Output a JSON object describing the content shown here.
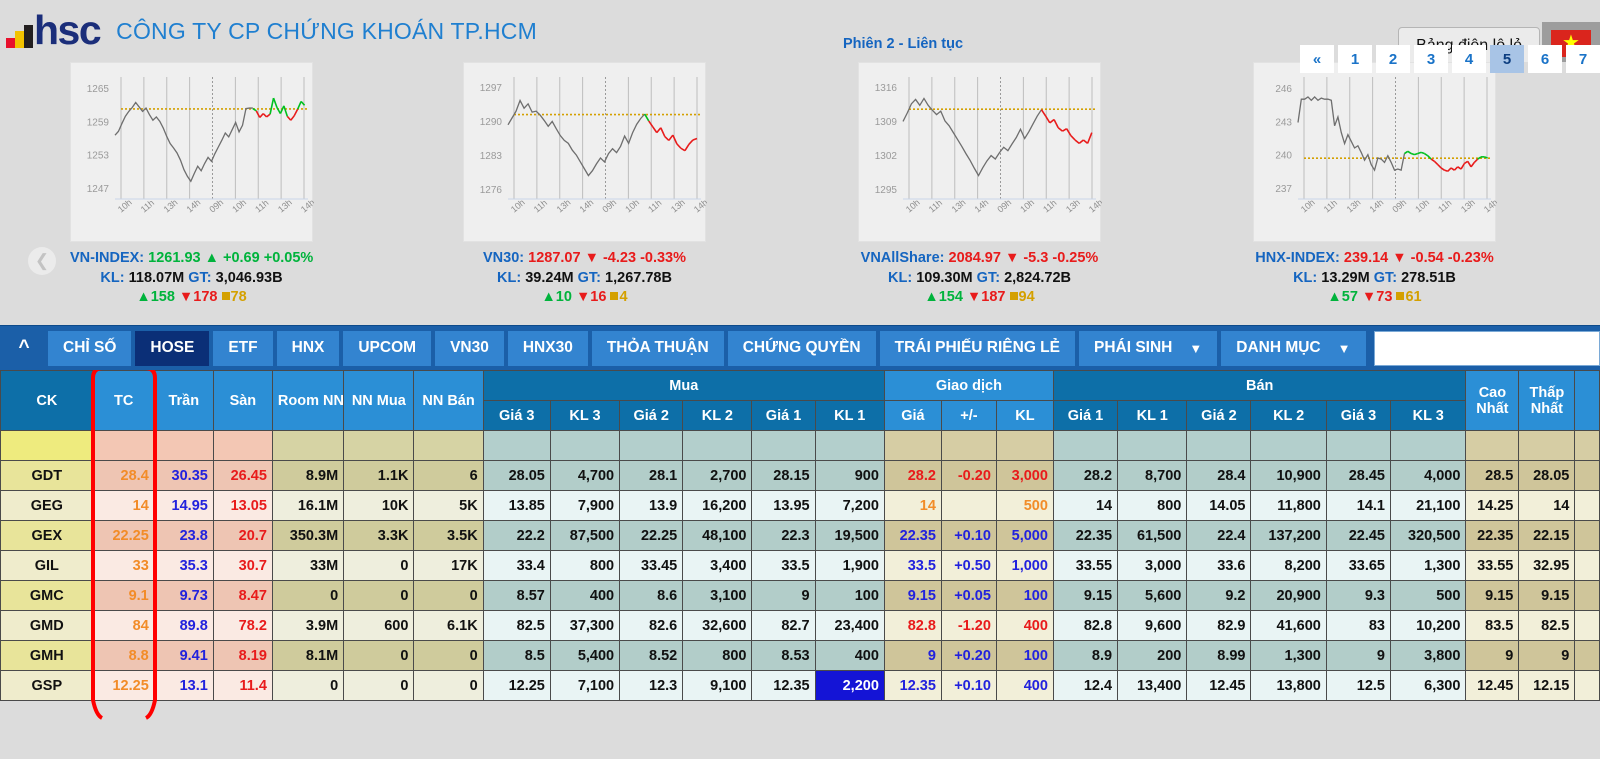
{
  "header": {
    "logo_text": "hsc",
    "company_name": "CÔNG TY CP CHỨNG KHOÁN TP.HCM",
    "session_status": "Phiên 2 - Liên tục",
    "lot_button": "Bảng điện lô lẻ",
    "flag_icon": "vietnam-flag-icon",
    "prev_arrow_icon": "chevron-left-icon"
  },
  "indices": [
    {
      "name": "VN-INDEX",
      "value": "1261.93",
      "dir": "up",
      "arrow": "▲",
      "change": "+0.69",
      "percent": "+0.05%",
      "vol_label": "KL:",
      "vol": "118.07M",
      "val_label": "GT:",
      "val": "3,046.93B",
      "advancers": "158",
      "decliners": "178",
      "unchanged": "78",
      "chart_data": {
        "type": "line",
        "title": "VN-INDEX",
        "yticks": [
          1265,
          1259,
          1253,
          1247
        ],
        "ylim": [
          1245,
          1267
        ],
        "xticks": [
          "10h",
          "11h",
          "13h",
          "14h",
          "09h",
          "10h",
          "11h",
          "13h",
          "14h"
        ],
        "reference": 1261.24,
        "prev_series": [
          1256.5,
          1257.2,
          1258.6,
          1259.9,
          1260.8,
          1261.5,
          1262.4,
          1261.6,
          1260.8,
          1261.4,
          1260.2,
          1259.2,
          1259.8,
          1259.0,
          1257.8,
          1256.3,
          1255.0,
          1254.2,
          1253.3,
          1252.0,
          1250.3,
          1249.1,
          1248.2,
          1249.6,
          1250.9,
          1250.1,
          1251.4,
          1252.5,
          1251.8,
          1253.2,
          1254.4,
          1255.6,
          1256.9,
          1256.2,
          1257.5,
          1258.8,
          1257.1,
          1258.3,
          1261.3,
          1261.4,
          1261.4
        ],
        "today_series": [
          1261.3,
          1260.9,
          1259.7,
          1260.4,
          1259.8,
          1260.3,
          1263.2,
          1261.5,
          1260.4,
          1261.8,
          1259.9,
          1259.2,
          1260.0,
          1261.2,
          1262.6,
          1261.9
        ],
        "today_color": "mixed"
      }
    },
    {
      "name": "VN30",
      "value": "1287.07",
      "dir": "down",
      "arrow": "▼",
      "change": "-4.23",
      "percent": "-0.33%",
      "vol_label": "KL:",
      "vol": "39.24M",
      "val_label": "GT:",
      "val": "1,267.78B",
      "advancers": "10",
      "decliners": "16",
      "unchanged": "4",
      "chart_data": {
        "type": "line",
        "title": "VN30",
        "yticks": [
          1297,
          1290,
          1283,
          1276
        ],
        "ylim": [
          1274,
          1299
        ],
        "xticks": [
          "10h",
          "11h",
          "13h",
          "14h",
          "09h",
          "10h",
          "11h",
          "13h",
          "14h"
        ],
        "reference": 1291.3,
        "prev_series": [
          1289.2,
          1290.6,
          1292.0,
          1294.2,
          1292.6,
          1293.5,
          1291.8,
          1292.0,
          1291.2,
          1290.1,
          1288.9,
          1289.9,
          1288.4,
          1287.0,
          1286.0,
          1285.4,
          1284.0,
          1283.0,
          1281.6,
          1280.2,
          1278.8,
          1279.8,
          1281.2,
          1282.4,
          1281.6,
          1283.3,
          1284.3,
          1283.5,
          1284.8,
          1286.9,
          1285.4,
          1287.6,
          1289.3,
          1290.5,
          1291.4
        ],
        "today_series": [
          1291.4,
          1290.0,
          1288.8,
          1287.6,
          1288.6,
          1286.8,
          1286.0,
          1287.1,
          1285.3,
          1284.4,
          1283.9,
          1285.2,
          1286.1,
          1286.4
        ],
        "today_color": "down"
      }
    },
    {
      "name": "VNAllShare",
      "value": "2084.97",
      "dir": "down",
      "arrow": "▼",
      "change": "-5.3",
      "percent": "-0.25%",
      "vol_label": "KL:",
      "vol": "109.30M",
      "val_label": "GT:",
      "val": "2,824.72B",
      "advancers": "154",
      "decliners": "187",
      "unchanged": "94",
      "chart_data": {
        "type": "line",
        "title": "VNAllShare",
        "yticks": [
          1316,
          1309,
          1302,
          1295
        ],
        "ylim": [
          1293,
          1318
        ],
        "xticks": [
          "10h",
          "11h",
          "13h",
          "14h",
          "09h",
          "10h",
          "11h",
          "13h",
          "14h"
        ],
        "reference": 1311.4,
        "prev_series": [
          1308.9,
          1310.6,
          1312.5,
          1313.4,
          1312.2,
          1313.6,
          1312.2,
          1311.2,
          1310.3,
          1311.0,
          1309.0,
          1308.0,
          1306.6,
          1305.2,
          1303.8,
          1302.3,
          1300.9,
          1299.3,
          1297.8,
          1299.4,
          1300.8,
          1301.9,
          1301.2,
          1302.5,
          1303.6,
          1302.9,
          1304.3,
          1305.6,
          1307.3,
          1305.4,
          1306.8,
          1308.4,
          1310.0,
          1311.3
        ],
        "today_series": [
          1311.3,
          1310.0,
          1308.6,
          1309.3,
          1307.6,
          1306.9,
          1307.4,
          1306.0,
          1305.1,
          1304.4,
          1305.1,
          1304.4,
          1306.6
        ],
        "today_color": "down"
      }
    },
    {
      "name": "HNX-INDEX",
      "value": "239.14",
      "dir": "down",
      "arrow": "▼",
      "change": "-0.54",
      "percent": "-0.23%",
      "vol_label": "KL:",
      "vol": "13.29M",
      "val_label": "GT:",
      "val": "278.51B",
      "advancers": "57",
      "decliners": "73",
      "unchanged": "61",
      "chart_data": {
        "type": "line",
        "title": "HNX-INDEX",
        "yticks": [
          246,
          243,
          240,
          237
        ],
        "ylim": [
          236,
          247
        ],
        "xticks": [
          "10h",
          "11h",
          "13h",
          "14h",
          "09h",
          "10h",
          "11h",
          "13h",
          "14h"
        ],
        "reference": 239.68,
        "prev_series": [
          242.9,
          245.0,
          245.0,
          245.2,
          244.9,
          245.2,
          244.9,
          245.1,
          245.0,
          245.0,
          244.9,
          242.6,
          243.4,
          242.0,
          241.0,
          241.8,
          241.2,
          240.6,
          240.8,
          240.2,
          239.5,
          240.0,
          239.1,
          238.6,
          239.7,
          239.6,
          239.3,
          239.9,
          239.3,
          238.6,
          238.7,
          238.6,
          240.1
        ],
        "today_series": [
          240.1,
          240.3,
          240.1,
          240.0,
          240.1,
          240.2,
          240.1,
          239.9,
          239.6,
          239.4,
          239.1,
          238.8,
          238.6,
          238.5,
          238.8,
          238.6,
          238.9,
          238.7,
          239.2,
          239.4,
          238.9,
          239.3,
          239.6,
          239.8,
          239.8,
          239.7
        ],
        "today_color": "mixed-down"
      }
    }
  ],
  "nav": {
    "collapse_icon": "chevron-up-icon",
    "tabs": [
      {
        "label": "CHỈ SỐ",
        "active": false,
        "chevron": false
      },
      {
        "label": "HOSE",
        "active": true,
        "chevron": false
      },
      {
        "label": "ETF",
        "active": false,
        "chevron": false
      },
      {
        "label": "HNX",
        "active": false,
        "chevron": false
      },
      {
        "label": "UPCOM",
        "active": false,
        "chevron": false
      },
      {
        "label": "VN30",
        "active": false,
        "chevron": false
      },
      {
        "label": "HNX30",
        "active": false,
        "chevron": false
      },
      {
        "label": "THỎA THUẬN",
        "active": false,
        "chevron": false
      },
      {
        "label": "CHỨNG QUYỀN",
        "active": false,
        "chevron": false
      },
      {
        "label": "TRÁI PHIẾU RIÊNG LẺ",
        "active": false,
        "chevron": false
      },
      {
        "label": "PHÁI SINH",
        "active": false,
        "chevron": true
      },
      {
        "label": "DANH MỤC",
        "active": false,
        "chevron": true
      }
    ],
    "search_value": "",
    "search_placeholder": ""
  },
  "pagination": {
    "prev_label": "«",
    "pages": [
      "1",
      "2",
      "3",
      "4",
      "5",
      "6",
      "7"
    ],
    "active_page": "5"
  },
  "table": {
    "group_headers": {
      "ck": "CK",
      "tc": "TC",
      "tran": "Trần",
      "san": "Sàn",
      "room_nn": "Room NN",
      "nn_mua": "NN Mua",
      "nn_ban": "NN Bán",
      "mua": "Mua",
      "giao_dich": "Giao dịch",
      "ban": "Bán",
      "cao_nhat_1": "Cao",
      "cao_nhat_2": "Nhất",
      "thap_nhat_1": "Thấp",
      "thap_nhat_2": "Nhất"
    },
    "sub_headers": {
      "gia3": "Giá 3",
      "kl3": "KL 3",
      "gia2": "Giá 2",
      "kl2": "KL 2",
      "gia1": "Giá 1",
      "kl1": "KL 1",
      "gd_gia": "Giá",
      "gd_pm": "+/-",
      "gd_kl": "KL",
      "s_gia1": "Giá 1",
      "s_kl1": "KL 1",
      "s_gia2": "Giá 2",
      "s_kl2": "KL 2",
      "s_gia3": "Giá 3",
      "s_kl3": "KL 3"
    },
    "rows": [
      {
        "ck": "GDT",
        "tc": "28.4",
        "tc_c": "or",
        "tran": "30.35",
        "tran_c": "bl",
        "san": "26.45",
        "san_c": "rd",
        "room_nn": "8.9M",
        "nn_mua": "1.1K",
        "nn_ban": "6",
        "m_gia3": "28.05",
        "m_kl3": "4,700",
        "m_gia2": "28.1",
        "m_kl2": "2,700",
        "m_gia1": "28.15",
        "m_kl1": "900",
        "g_gia": "28.2",
        "g_gia_c": "rd",
        "g_pm": "-0.20",
        "g_pm_c": "rd",
        "g_kl": "3,000",
        "g_kl_c": "rd",
        "b_gia1": "28.2",
        "b_kl1": "8,700",
        "b_gia2": "28.4",
        "b_kl2": "10,900",
        "b_gia3": "28.45",
        "b_kl3": "4,000",
        "cao": "28.5",
        "thap": "28.05",
        "hl": ""
      },
      {
        "ck": "GEG",
        "tc": "14",
        "tc_c": "or",
        "tran": "14.95",
        "tran_c": "bl",
        "san": "13.05",
        "san_c": "rd",
        "room_nn": "16.1M",
        "nn_mua": "10K",
        "nn_ban": "5K",
        "m_gia3": "13.85",
        "m_kl3": "7,900",
        "m_gia2": "13.9",
        "m_kl2": "16,200",
        "m_gia1": "13.95",
        "m_kl1": "7,200",
        "g_gia": "14",
        "g_gia_c": "or",
        "g_pm": "",
        "g_pm_c": "or",
        "g_kl": "500",
        "g_kl_c": "or",
        "b_gia1": "14",
        "b_kl1": "800",
        "b_gia2": "14.05",
        "b_kl2": "11,800",
        "b_gia3": "14.1",
        "b_kl3": "21,100",
        "cao": "14.25",
        "thap": "14",
        "hl": ""
      },
      {
        "ck": "GEX",
        "tc": "22.25",
        "tc_c": "or",
        "tran": "23.8",
        "tran_c": "bl",
        "san": "20.7",
        "san_c": "rd",
        "room_nn": "350.3M",
        "nn_mua": "3.3K",
        "nn_ban": "3.5K",
        "m_gia3": "22.2",
        "m_kl3": "87,500",
        "m_gia2": "22.25",
        "m_kl2": "48,100",
        "m_gia1": "22.3",
        "m_kl1": "19,500",
        "g_gia": "22.35",
        "g_gia_c": "bl",
        "g_pm": "+0.10",
        "g_pm_c": "bl",
        "g_kl": "5,000",
        "g_kl_c": "bl",
        "b_gia1": "22.35",
        "b_kl1": "61,500",
        "b_gia2": "22.4",
        "b_kl2": "137,200",
        "b_gia3": "22.45",
        "b_kl3": "320,500",
        "cao": "22.35",
        "thap": "22.15",
        "hl": ""
      },
      {
        "ck": "GIL",
        "tc": "33",
        "tc_c": "or",
        "tran": "35.3",
        "tran_c": "bl",
        "san": "30.7",
        "san_c": "rd",
        "room_nn": "33M",
        "nn_mua": "0",
        "nn_ban": "17K",
        "m_gia3": "33.4",
        "m_kl3": "800",
        "m_gia2": "33.45",
        "m_kl2": "3,400",
        "m_gia1": "33.5",
        "m_kl1": "1,900",
        "g_gia": "33.5",
        "g_gia_c": "bl",
        "g_pm": "+0.50",
        "g_pm_c": "bl",
        "g_kl": "1,000",
        "g_kl_c": "bl",
        "b_gia1": "33.55",
        "b_kl1": "3,000",
        "b_gia2": "33.6",
        "b_kl2": "8,200",
        "b_gia3": "33.65",
        "b_kl3": "1,300",
        "cao": "33.55",
        "thap": "32.95",
        "hl": ""
      },
      {
        "ck": "GMC",
        "tc": "9.1",
        "tc_c": "or",
        "tran": "9.73",
        "tran_c": "bl",
        "san": "8.47",
        "san_c": "rd",
        "room_nn": "0",
        "nn_mua": "0",
        "nn_ban": "0",
        "m_gia3": "8.57",
        "m_kl3": "400",
        "m_gia2": "8.6",
        "m_kl2": "3,100",
        "m_gia1": "9",
        "m_kl1": "100",
        "g_gia": "9.15",
        "g_gia_c": "bl",
        "g_pm": "+0.05",
        "g_pm_c": "bl",
        "g_kl": "100",
        "g_kl_c": "bl",
        "b_gia1": "9.15",
        "b_kl1": "5,600",
        "b_gia2": "9.2",
        "b_kl2": "20,900",
        "b_gia3": "9.3",
        "b_kl3": "500",
        "cao": "9.15",
        "thap": "9.15",
        "hl": ""
      },
      {
        "ck": "GMD",
        "tc": "84",
        "tc_c": "or",
        "tran": "89.8",
        "tran_c": "bl",
        "san": "78.2",
        "san_c": "rd",
        "room_nn": "3.9M",
        "nn_mua": "600",
        "nn_ban": "6.1K",
        "m_gia3": "82.5",
        "m_kl3": "37,300",
        "m_gia2": "82.6",
        "m_kl2": "32,600",
        "m_gia1": "82.7",
        "m_kl1": "23,400",
        "g_gia": "82.8",
        "g_gia_c": "rd",
        "g_pm": "-1.20",
        "g_pm_c": "rd",
        "g_kl": "400",
        "g_kl_c": "rd",
        "b_gia1": "82.8",
        "b_kl1": "9,600",
        "b_gia2": "82.9",
        "b_kl2": "41,600",
        "b_gia3": "83",
        "b_kl3": "10,200",
        "cao": "83.5",
        "thap": "82.5",
        "hl": ""
      },
      {
        "ck": "GMH",
        "tc": "8.8",
        "tc_c": "or",
        "tran": "9.41",
        "tran_c": "bl",
        "san": "8.19",
        "san_c": "rd",
        "room_nn": "8.1M",
        "nn_mua": "0",
        "nn_ban": "0",
        "m_gia3": "8.5",
        "m_kl3": "5,400",
        "m_gia2": "8.52",
        "m_kl2": "800",
        "m_gia1": "8.53",
        "m_kl1": "400",
        "g_gia": "9",
        "g_gia_c": "bl",
        "g_pm": "+0.20",
        "g_pm_c": "bl",
        "g_kl": "100",
        "g_kl_c": "bl",
        "b_gia1": "8.9",
        "b_kl1": "200",
        "b_gia2": "8.99",
        "b_kl2": "1,300",
        "b_gia3": "9",
        "b_kl3": "3,800",
        "cao": "9",
        "thap": "9",
        "hl": ""
      },
      {
        "ck": "GSP",
        "tc": "12.25",
        "tc_c": "or",
        "tran": "13.1",
        "tran_c": "bl",
        "san": "11.4",
        "san_c": "rd",
        "room_nn": "0",
        "nn_mua": "0",
        "nn_ban": "0",
        "m_gia3": "12.25",
        "m_kl3": "7,100",
        "m_gia2": "12.3",
        "m_kl2": "9,100",
        "m_gia1": "12.35",
        "m_kl1": "2,200",
        "g_gia": "12.35",
        "g_gia_c": "bl",
        "g_pm": "+0.10",
        "g_pm_c": "bl",
        "g_kl": "400",
        "g_kl_c": "bl",
        "b_gia1": "12.4",
        "b_kl1": "13,400",
        "b_gia2": "12.45",
        "b_kl2": "13,800",
        "b_gia3": "12.5",
        "b_kl3": "6,300",
        "cao": "12.45",
        "thap": "12.15",
        "hl": "m_kl1"
      }
    ]
  },
  "colors": {
    "accent_blue": "#1565c0",
    "tab_blue": "#3384d0",
    "tab_active": "#0b2f77",
    "up_green": "#00b33c",
    "down_red": "#e81b1b",
    "ref_yellow": "#d4a000",
    "highlight": "#1414d6",
    "annotation_red": "#ff0000"
  }
}
